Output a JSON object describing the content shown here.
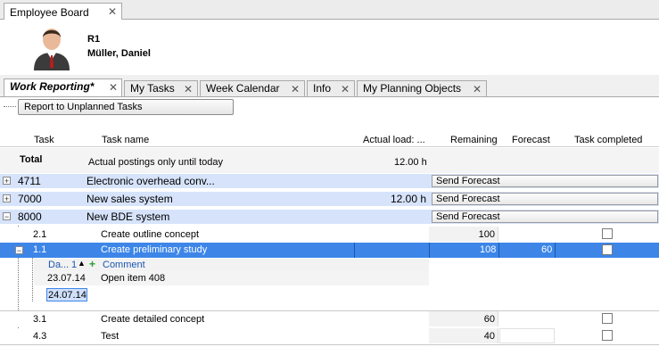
{
  "window": {
    "doc_tab": "Employee Board"
  },
  "employee": {
    "id": "R1",
    "name": "Müller, Daniel"
  },
  "tabs": [
    {
      "label": "Work Reporting*",
      "active": true
    },
    {
      "label": "My Tasks",
      "active": false
    },
    {
      "label": "Week Calendar",
      "active": false
    },
    {
      "label": "Info",
      "active": false
    },
    {
      "label": "My Planning Objects",
      "active": false
    }
  ],
  "toolbar": {
    "report_button": "Report to Unplanned Tasks"
  },
  "columns": {
    "task": "Task",
    "task_name": "Task name",
    "actual_load": "Actual load: ...",
    "remaining": "Remaining",
    "forecast": "Forecast",
    "task_completed": "Task completed"
  },
  "total_row": {
    "label": "Total",
    "note": "Actual postings only until today",
    "actual": "12.00 h"
  },
  "send_forecast_label": "Send Forecast",
  "groups": [
    {
      "task": "4711",
      "name": "Electronic overhead conv...",
      "actual": ""
    },
    {
      "task": "7000",
      "name": "New sales system",
      "actual": "12.00 h"
    },
    {
      "task": "8000",
      "name": "New BDE system",
      "actual": ""
    }
  ],
  "tasks": [
    {
      "task": "2.1",
      "name": "Create outline concept",
      "remaining": "100",
      "forecast": ""
    },
    {
      "task": "1.1",
      "name": "Create preliminary study",
      "remaining": "108",
      "forecast": "60"
    },
    {
      "task": "3.1",
      "name": "Create detailed concept",
      "remaining": "60",
      "forecast": ""
    },
    {
      "task": "4.3",
      "name": "Test",
      "remaining": "40",
      "forecast": ""
    }
  ],
  "comments": {
    "col_date": "Da...",
    "col_sort": "1",
    "col_comment": "Comment",
    "rows": [
      {
        "date": "23.07.14",
        "comment": "Open item 408"
      }
    ],
    "editing_date": "24.07.14"
  }
}
